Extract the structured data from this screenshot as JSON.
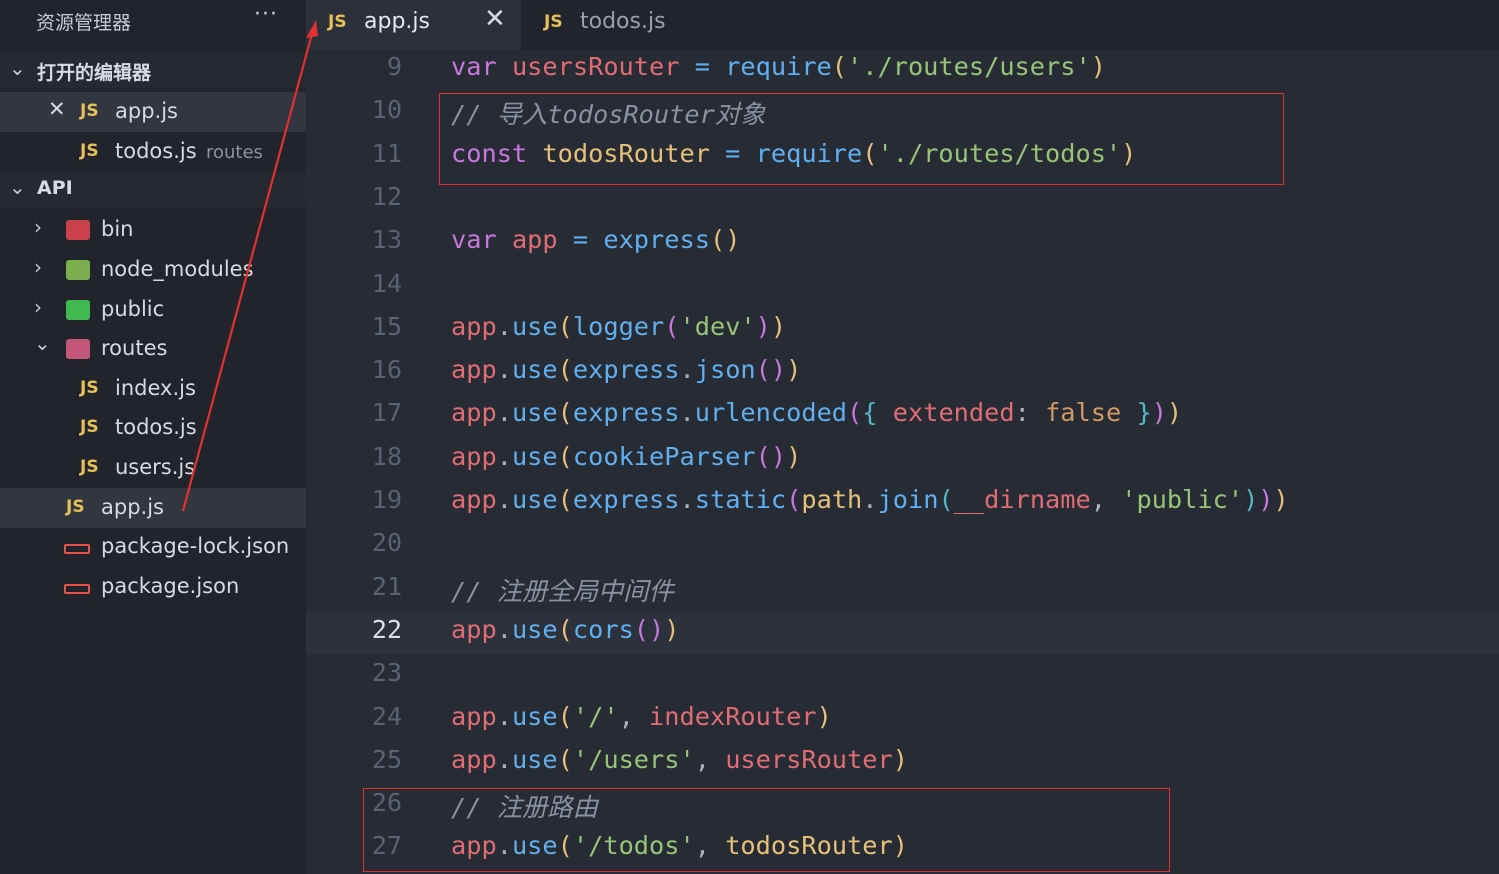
{
  "sidebar": {
    "title": "资源管理器",
    "more": "···",
    "open_editors": {
      "label": "打开的编辑器",
      "items": [
        {
          "name": "app.js",
          "desc": ""
        },
        {
          "name": "todos.js",
          "desc": "routes"
        }
      ]
    },
    "project": {
      "label": "API",
      "items": [
        {
          "name": "bin"
        },
        {
          "name": "node_modules"
        },
        {
          "name": "public"
        },
        {
          "name": "routes"
        },
        {
          "name": "index.js"
        },
        {
          "name": "todos.js"
        },
        {
          "name": "users.js"
        },
        {
          "name": "app.js"
        },
        {
          "name": "package-lock.json"
        },
        {
          "name": "package.json"
        }
      ]
    }
  },
  "tabs": [
    {
      "label": "app.js",
      "active": true
    },
    {
      "label": "todos.js",
      "active": false
    }
  ],
  "icons": {
    "js": "JS",
    "close": "✕",
    "chevron_down": "⌄",
    "chevron_right": "›"
  },
  "editor": {
    "current_line": 22,
    "lines": [
      {
        "n": "9",
        "tokens": [
          [
            "kw",
            "var"
          ],
          [
            "t",
            " "
          ],
          [
            "var",
            "usersRouter"
          ],
          [
            "t",
            " "
          ],
          [
            "fn",
            "="
          ],
          [
            "t",
            " "
          ],
          [
            "fn",
            "require"
          ],
          [
            "p1",
            "("
          ],
          [
            "str",
            "'./routes/users'"
          ],
          [
            "p1",
            ")"
          ]
        ]
      },
      {
        "n": "10",
        "tokens": [
          [
            "cm",
            "// 导入todosRouter对象"
          ]
        ]
      },
      {
        "n": "11",
        "tokens": [
          [
            "kw",
            "const"
          ],
          [
            "t",
            " "
          ],
          [
            "plain",
            "todosRouter"
          ],
          [
            "t",
            " "
          ],
          [
            "fn",
            "="
          ],
          [
            "t",
            " "
          ],
          [
            "fn",
            "require"
          ],
          [
            "p1",
            "("
          ],
          [
            "str",
            "'./routes/todos'"
          ],
          [
            "p1",
            ")"
          ]
        ]
      },
      {
        "n": "12",
        "tokens": []
      },
      {
        "n": "13",
        "tokens": [
          [
            "kw",
            "var"
          ],
          [
            "t",
            " "
          ],
          [
            "var",
            "app"
          ],
          [
            "t",
            " "
          ],
          [
            "fn",
            "="
          ],
          [
            "t",
            " "
          ],
          [
            "fn",
            "express"
          ],
          [
            "p1",
            "()"
          ]
        ]
      },
      {
        "n": "14",
        "tokens": []
      },
      {
        "n": "15",
        "tokens": [
          [
            "var",
            "app"
          ],
          [
            "pun",
            "."
          ],
          [
            "fn",
            "use"
          ],
          [
            "p1",
            "("
          ],
          [
            "fn",
            "logger"
          ],
          [
            "p2",
            "("
          ],
          [
            "str",
            "'dev'"
          ],
          [
            "p2",
            ")"
          ],
          [
            "p1",
            ")"
          ]
        ]
      },
      {
        "n": "16",
        "tokens": [
          [
            "var",
            "app"
          ],
          [
            "pun",
            "."
          ],
          [
            "fn",
            "use"
          ],
          [
            "p1",
            "("
          ],
          [
            "fn",
            "express"
          ],
          [
            "pun",
            "."
          ],
          [
            "fn",
            "json"
          ],
          [
            "p2",
            "()"
          ],
          [
            "p1",
            ")"
          ]
        ]
      },
      {
        "n": "17",
        "tokens": [
          [
            "var",
            "app"
          ],
          [
            "pun",
            "."
          ],
          [
            "fn",
            "use"
          ],
          [
            "p1",
            "("
          ],
          [
            "fn",
            "express"
          ],
          [
            "pun",
            "."
          ],
          [
            "fn",
            "urlencoded"
          ],
          [
            "p2",
            "("
          ],
          [
            "p3",
            "{"
          ],
          [
            "t",
            " "
          ],
          [
            "var",
            "extended"
          ],
          [
            "pun",
            ":"
          ],
          [
            "t",
            " "
          ],
          [
            "fal",
            "false"
          ],
          [
            "t",
            " "
          ],
          [
            "p3",
            "}"
          ],
          [
            "p2",
            ")"
          ],
          [
            "p1",
            ")"
          ]
        ]
      },
      {
        "n": "18",
        "tokens": [
          [
            "var",
            "app"
          ],
          [
            "pun",
            "."
          ],
          [
            "fn",
            "use"
          ],
          [
            "p1",
            "("
          ],
          [
            "fn",
            "cookieParser"
          ],
          [
            "p2",
            "()"
          ],
          [
            "p1",
            ")"
          ]
        ]
      },
      {
        "n": "19",
        "tokens": [
          [
            "var",
            "app"
          ],
          [
            "pun",
            "."
          ],
          [
            "fn",
            "use"
          ],
          [
            "p1",
            "("
          ],
          [
            "fn",
            "express"
          ],
          [
            "pun",
            "."
          ],
          [
            "fn",
            "static"
          ],
          [
            "p2",
            "("
          ],
          [
            "plain",
            "path"
          ],
          [
            "pun",
            "."
          ],
          [
            "fn",
            "join"
          ],
          [
            "p3",
            "("
          ],
          [
            "var",
            "__dirname"
          ],
          [
            "pun",
            ","
          ],
          [
            "t",
            " "
          ],
          [
            "str",
            "'public'"
          ],
          [
            "p3",
            ")"
          ],
          [
            "p2",
            ")"
          ],
          [
            "p1",
            ")"
          ]
        ]
      },
      {
        "n": "20",
        "tokens": []
      },
      {
        "n": "21",
        "tokens": [
          [
            "cm",
            "// 注册全局中间件"
          ]
        ]
      },
      {
        "n": "22",
        "tokens": [
          [
            "var",
            "app"
          ],
          [
            "pun",
            "."
          ],
          [
            "fn",
            "use"
          ],
          [
            "p1",
            "("
          ],
          [
            "fn",
            "cors"
          ],
          [
            "p2",
            "()"
          ],
          [
            "p1",
            ")"
          ]
        ]
      },
      {
        "n": "23",
        "tokens": []
      },
      {
        "n": "24",
        "tokens": [
          [
            "var",
            "app"
          ],
          [
            "pun",
            "."
          ],
          [
            "fn",
            "use"
          ],
          [
            "p1",
            "("
          ],
          [
            "str",
            "'/'"
          ],
          [
            "pun",
            ","
          ],
          [
            "t",
            " "
          ],
          [
            "var",
            "indexRouter"
          ],
          [
            "p1",
            ")"
          ]
        ]
      },
      {
        "n": "25",
        "tokens": [
          [
            "var",
            "app"
          ],
          [
            "pun",
            "."
          ],
          [
            "fn",
            "use"
          ],
          [
            "p1",
            "("
          ],
          [
            "str",
            "'/users'"
          ],
          [
            "pun",
            ","
          ],
          [
            "t",
            " "
          ],
          [
            "var",
            "usersRouter"
          ],
          [
            "p1",
            ")"
          ]
        ]
      },
      {
        "n": "26",
        "tokens": [
          [
            "cm",
            "// 注册路由"
          ]
        ]
      },
      {
        "n": "27",
        "tokens": [
          [
            "var",
            "app"
          ],
          [
            "pun",
            "."
          ],
          [
            "fn",
            "use"
          ],
          [
            "p1",
            "("
          ],
          [
            "str",
            "'/todos'"
          ],
          [
            "pun",
            ","
          ],
          [
            "t",
            " "
          ],
          [
            "plain",
            "todosRouter"
          ],
          [
            "p1",
            ")"
          ]
        ]
      }
    ]
  },
  "colors": {
    "highlight_box": "#e03030",
    "arrow": "#e03030",
    "js_icon": "#e5c15a"
  }
}
